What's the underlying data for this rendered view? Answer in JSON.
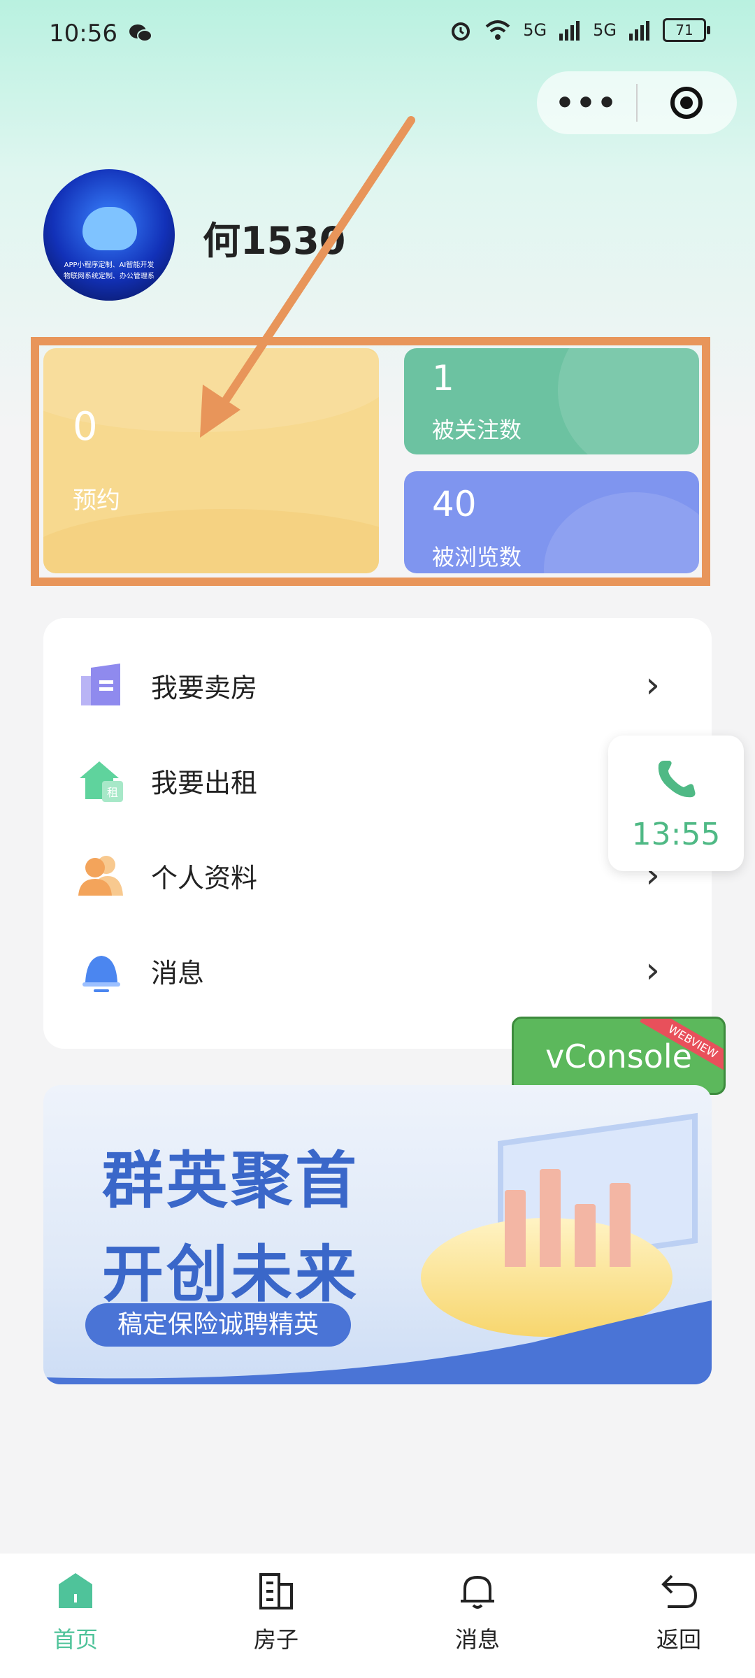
{
  "status_bar": {
    "time": "10:56",
    "network_1": "5G",
    "network_2": "5G",
    "battery": "71"
  },
  "capsule": {
    "more_label": "•••"
  },
  "profile": {
    "username": "何1530",
    "avatar_caption_1": "APP小程序定制、AI智能开发",
    "avatar_caption_2": "物联网系统定制、办公管理系"
  },
  "stats": {
    "reserve": {
      "value": "0",
      "label": "预约"
    },
    "followed": {
      "value": "1",
      "label": "被关注数"
    },
    "viewed": {
      "value": "40",
      "label": "被浏览数"
    }
  },
  "menu": {
    "items": [
      {
        "label": "我要卖房",
        "icon": "building-icon"
      },
      {
        "label": "我要出租",
        "icon": "house-rent-icon"
      },
      {
        "label": "个人资料",
        "icon": "user-icon"
      },
      {
        "label": "消息",
        "icon": "bell-icon"
      }
    ],
    "chevron": "›"
  },
  "float_call": {
    "time": "13:55",
    "color": "#4fb985"
  },
  "vconsole": {
    "label": "vConsole",
    "ribbon": "WEBVIEW"
  },
  "banner": {
    "line1": "群英聚首",
    "line2": "开创未来",
    "tagline": "稿定保险诚聘精英"
  },
  "bottom_nav": {
    "items": [
      {
        "label": "首页",
        "icon": "home-icon",
        "active": true
      },
      {
        "label": "房子",
        "icon": "building-icon",
        "active": false
      },
      {
        "label": "消息",
        "icon": "bell-icon",
        "active": false
      },
      {
        "label": "返回",
        "icon": "back-icon",
        "active": false
      }
    ]
  },
  "colors": {
    "accent": "#4fc39a",
    "annotation": "#e8955a"
  }
}
